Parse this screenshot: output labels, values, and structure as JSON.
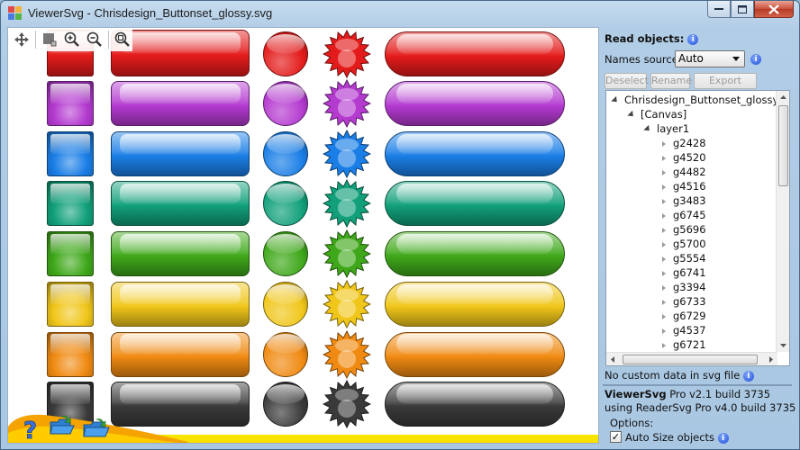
{
  "window": {
    "title": "ViewerSvg - Chrisdesign_Buttonset_glossy.svg",
    "caption_buttons": [
      "minimize",
      "maximize",
      "close"
    ]
  },
  "toolbar": {
    "icons": [
      "move-icon",
      "select-rect-icon",
      "zoom-in-icon",
      "zoom-out-icon",
      "zoom-fit-icon"
    ]
  },
  "button_rows": [
    {
      "color": "#e41b1b"
    },
    {
      "color": "#b43ad0"
    },
    {
      "color": "#1a7ee6"
    },
    {
      "color": "#11a07a"
    },
    {
      "color": "#3fa81a"
    },
    {
      "color": "#f0c61a"
    },
    {
      "color": "#f08a12"
    },
    {
      "color": "#3a3a3a"
    }
  ],
  "panel": {
    "read_objects_label": "Read objects",
    "names_source_label": "Names source:",
    "names_source_value": "Auto",
    "deselect_label": "Deselect",
    "rename_label": "Rename",
    "export_label": "Export image",
    "tree": {
      "root": "Chrisdesign_Buttonset_glossy.svg",
      "canvas": "[Canvas]",
      "layer": "layer1",
      "groups": [
        "g2428",
        "g4520",
        "g4482",
        "g4516",
        "g3483",
        "g6745",
        "g5696",
        "g5700",
        "g5554",
        "g6741",
        "g3394",
        "g6733",
        "g6729",
        "g4537",
        "g6721"
      ]
    },
    "no_custom_data": "No custom data in svg file",
    "version_bold": "ViewerSvg",
    "version_rest": " Pro v2.1 build 3735",
    "using_line": "using ReaderSvg Pro v4.0 build 3735",
    "options_label": "Options:",
    "auto_size_label": "Auto Size objects",
    "auto_size_checked": true
  }
}
